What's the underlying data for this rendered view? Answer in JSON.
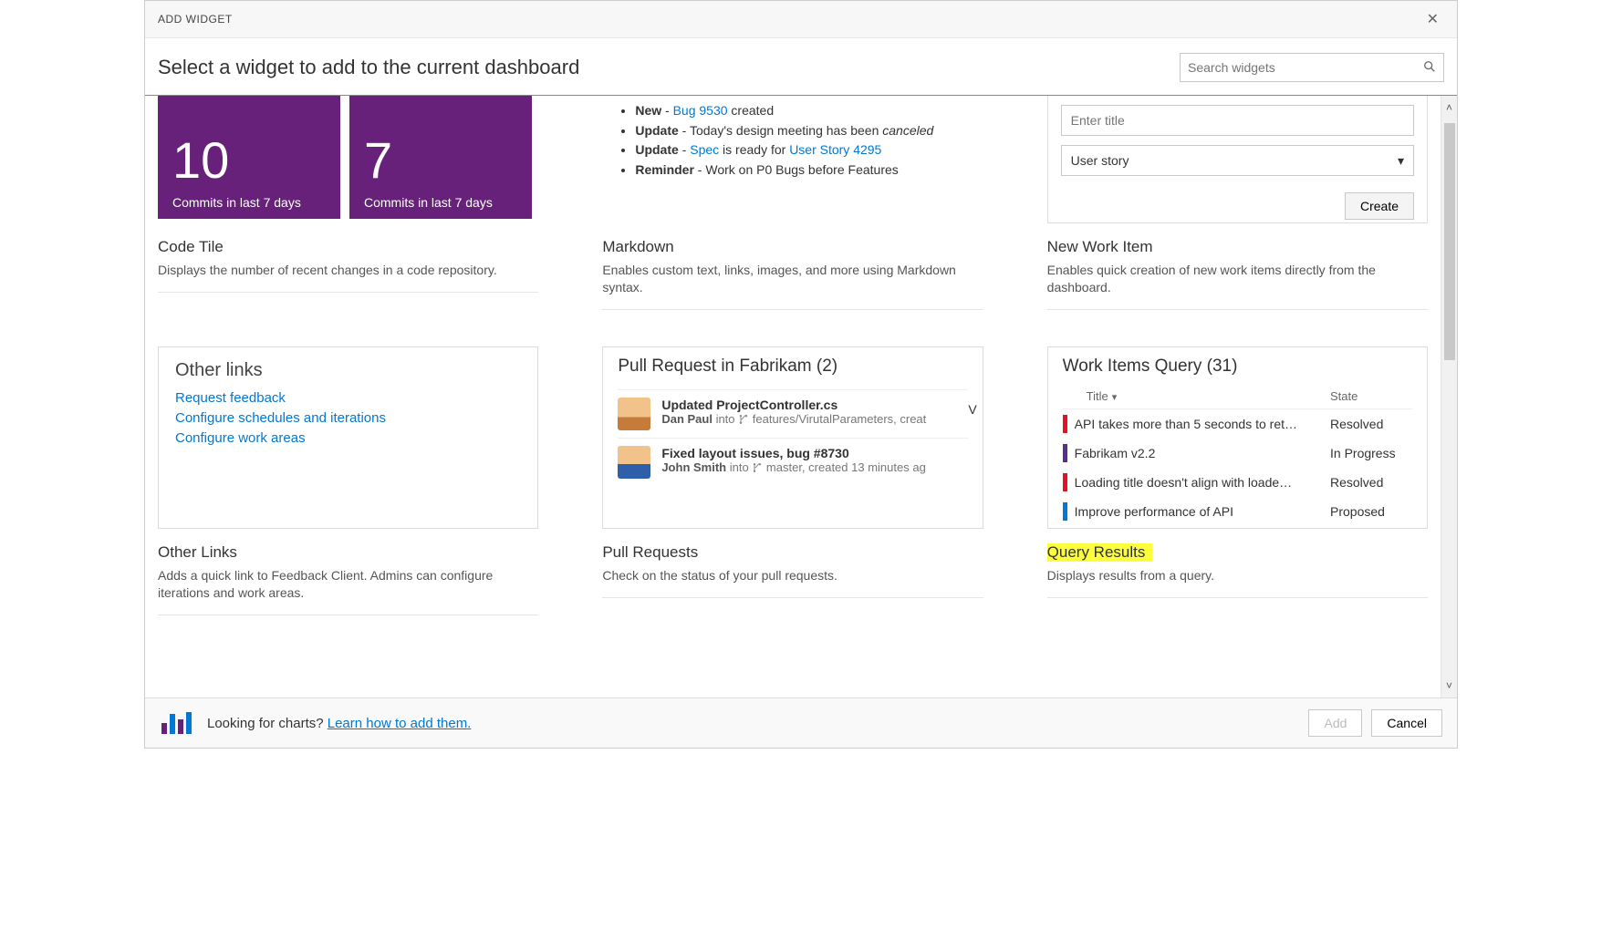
{
  "dialog": {
    "title": "ADD WIDGET"
  },
  "header": {
    "heading": "Select a widget to add to the current dashboard"
  },
  "search": {
    "placeholder": "Search widgets"
  },
  "widgets": {
    "code_tile": {
      "title": "Code Tile",
      "desc": "Displays the number of recent changes in a code repository.",
      "tiles": [
        {
          "value": "10",
          "label": "Commits in last 7 days"
        },
        {
          "value": "7",
          "label": "Commits in last 7 days"
        }
      ]
    },
    "markdown": {
      "title": "Markdown",
      "desc": "Enables custom text, links, images, and more using Markdown syntax.",
      "items": [
        {
          "prefix": "New",
          "sep": " - ",
          "link": "Bug 9530",
          "rest": " created"
        },
        {
          "prefix": "Update",
          "sep": " - ",
          "text": "Today's design meeting has been ",
          "italic": "canceled"
        },
        {
          "prefix": "Update",
          "sep": " - ",
          "link_pre": "Spec",
          "mid": " is ready for ",
          "link": "User Story 4295"
        },
        {
          "prefix": "Reminder",
          "sep": " - ",
          "text": "Work on P0 Bugs before Features"
        }
      ]
    },
    "new_work_item": {
      "title": "New Work Item",
      "desc": "Enables quick creation of new work items directly from the dashboard.",
      "placeholder": "Enter title",
      "type": "User story",
      "button": "Create"
    },
    "other_links": {
      "title": "Other Links",
      "desc": "Adds a quick link to Feedback Client. Admins can configure iterations and work areas.",
      "heading": "Other links",
      "links": [
        "Request feedback",
        "Configure schedules and iterations",
        "Configure work areas"
      ]
    },
    "pull_requests": {
      "title": "Pull Requests",
      "desc": "Check on the status of your pull requests.",
      "heading": "Pull Request in Fabrikam (2)",
      "rows": [
        {
          "line1": "Updated ProjectController.cs",
          "author": "Dan Paul",
          "into": " into ",
          "branch": "features/VirutalParameters, creat"
        },
        {
          "line1": "Fixed layout issues, bug #8730",
          "author": "John Smith",
          "into": " into ",
          "branch": "master, created 13 minutes ag"
        }
      ]
    },
    "query_results": {
      "title": "Query Results",
      "desc": "Displays results from a query.",
      "heading": "Work Items Query (31)",
      "col_title": "Title",
      "col_state": "State",
      "rows": [
        {
          "color": "#e81123",
          "title": "API takes more than 5 seconds to ret…",
          "state": "Resolved"
        },
        {
          "color": "#5c2d91",
          "title": "Fabrikam v2.2",
          "state": "In Progress"
        },
        {
          "color": "#e81123",
          "title": "Loading title doesn't align with loade…",
          "state": "Resolved"
        },
        {
          "color": "#0078d4",
          "title": "Improve performance of API",
          "state": "Proposed"
        }
      ]
    }
  },
  "footer": {
    "text": "Looking for charts? ",
    "link": "Learn how to add them.",
    "add": "Add",
    "cancel": "Cancel"
  }
}
